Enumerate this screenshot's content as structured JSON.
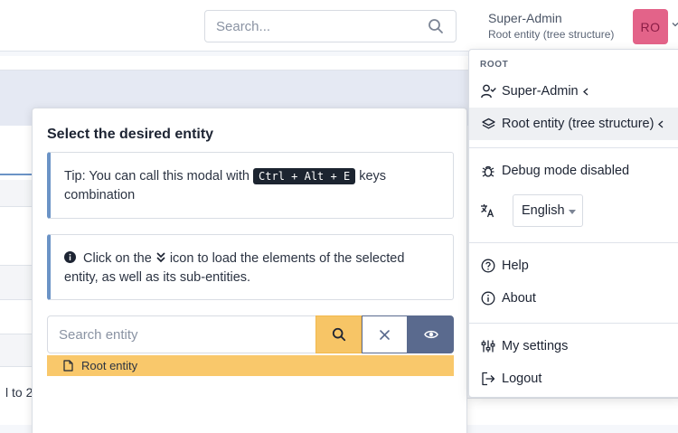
{
  "header": {
    "search_placeholder": "Search...",
    "user_name": "Super-Admin",
    "user_entity": "Root entity (tree structure)",
    "avatar_initials": "RO"
  },
  "background": {
    "pagination_text": "l to 2"
  },
  "modal": {
    "title": "Select the desired entity",
    "tip_before": "Tip: You can call this modal with ",
    "tip_shortcut": "Ctrl + Alt + E",
    "tip_after": " keys combination",
    "info_before": "Click on the ",
    "info_after": " icon to load the elements of the selected entity, as well as its sub-entities.",
    "search_placeholder": "Search entity",
    "tree_items": [
      "Root entity"
    ]
  },
  "menu": {
    "caption": "ROOT",
    "profile_label": "Super-Admin",
    "entity_label": "Root entity (tree structure)",
    "debug_label": "Debug mode disabled",
    "language_selected": "English",
    "help_label": "Help",
    "about_label": "About",
    "settings_label": "My settings",
    "logout_label": "Logout"
  },
  "colors": {
    "accent_blue": "#6b93c6",
    "avatar_pink": "#e36389",
    "search_button_yellow": "#f7c566",
    "tree_highlight": "#f9c86b",
    "eye_button_slate": "#5a6a8e"
  }
}
